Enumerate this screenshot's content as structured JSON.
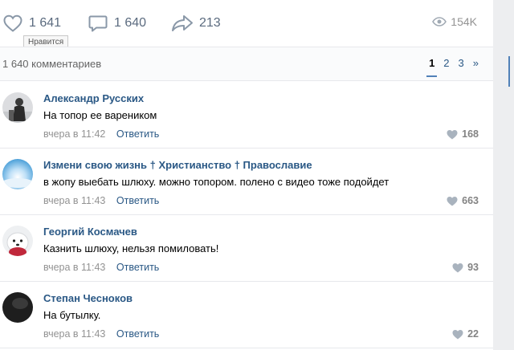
{
  "actions": {
    "likes": "1 641",
    "comments": "1 640",
    "shares": "213",
    "views": "154K",
    "like_tooltip": "Нравится"
  },
  "comments_header": {
    "count_label": "1 640 комментариев",
    "pages": [
      "1",
      "2",
      "3",
      "»"
    ]
  },
  "comments": [
    {
      "author": "Александр Русских",
      "text": "На топор ее вареником",
      "time": "вчера в 11:42",
      "reply_label": "Ответить",
      "likes": "168"
    },
    {
      "author": "Измени свою жизнь † Христианство † Православие",
      "text": "в жопу выебать шлюху. можно топором. полено с видео тоже подойдет",
      "time": "вчера в 11:43",
      "reply_label": "Ответить",
      "likes": "663"
    },
    {
      "author": "Георгий Космачев",
      "text": "Казнить шлюху, нельзя помиловать!",
      "time": "вчера в 11:43",
      "reply_label": "Ответить",
      "likes": "93"
    },
    {
      "author": "Степан Чесноков",
      "text": "На бутылку.",
      "time": "вчера в 11:43",
      "reply_label": "Ответить",
      "likes": "22"
    }
  ],
  "colors": {
    "link": "#2a5885",
    "accent": "#5181b8",
    "muted": "#939393"
  }
}
